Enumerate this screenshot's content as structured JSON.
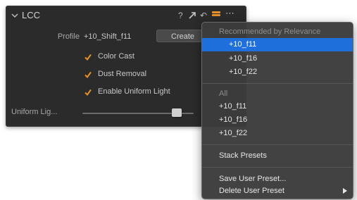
{
  "panel": {
    "title": "LCC",
    "help_icon_glyph": "?",
    "reset_icon_glyph": "↶",
    "more_icon_glyph": "⋯",
    "profile_label": "Profile",
    "profile_value": "+10_Shift_f11",
    "create_label": "Create",
    "checkboxes": [
      {
        "label": "Color Cast",
        "checked": true
      },
      {
        "label": "Dust Removal",
        "checked": true
      },
      {
        "label": "Enable Uniform Light",
        "checked": true
      }
    ],
    "slider_label": "Uniform Lig...",
    "slider_value_fraction": 0.85,
    "accent_color": "#e8912a",
    "icons": [
      "chevron-down-icon",
      "help-icon",
      "copy-adjustments-icon",
      "reset-icon",
      "presets-icon",
      "more-options-icon",
      "checkmark-icon"
    ]
  },
  "menu": {
    "recommended_header": "Recommended by Relevance",
    "recommended_items": [
      "+10_f11",
      "+10_f16",
      "+10_f22"
    ],
    "selected_index": 0,
    "all_header": "All",
    "all_items": [
      "+10_f11",
      "+10_f16",
      "+10_f22"
    ],
    "stack_presets": "Stack Presets",
    "save_user_preset": "Save User Preset...",
    "delete_user_preset": "Delete User Preset",
    "selection_color": "#1e6fdc",
    "icons": [
      "submenu-arrow-icon"
    ]
  }
}
